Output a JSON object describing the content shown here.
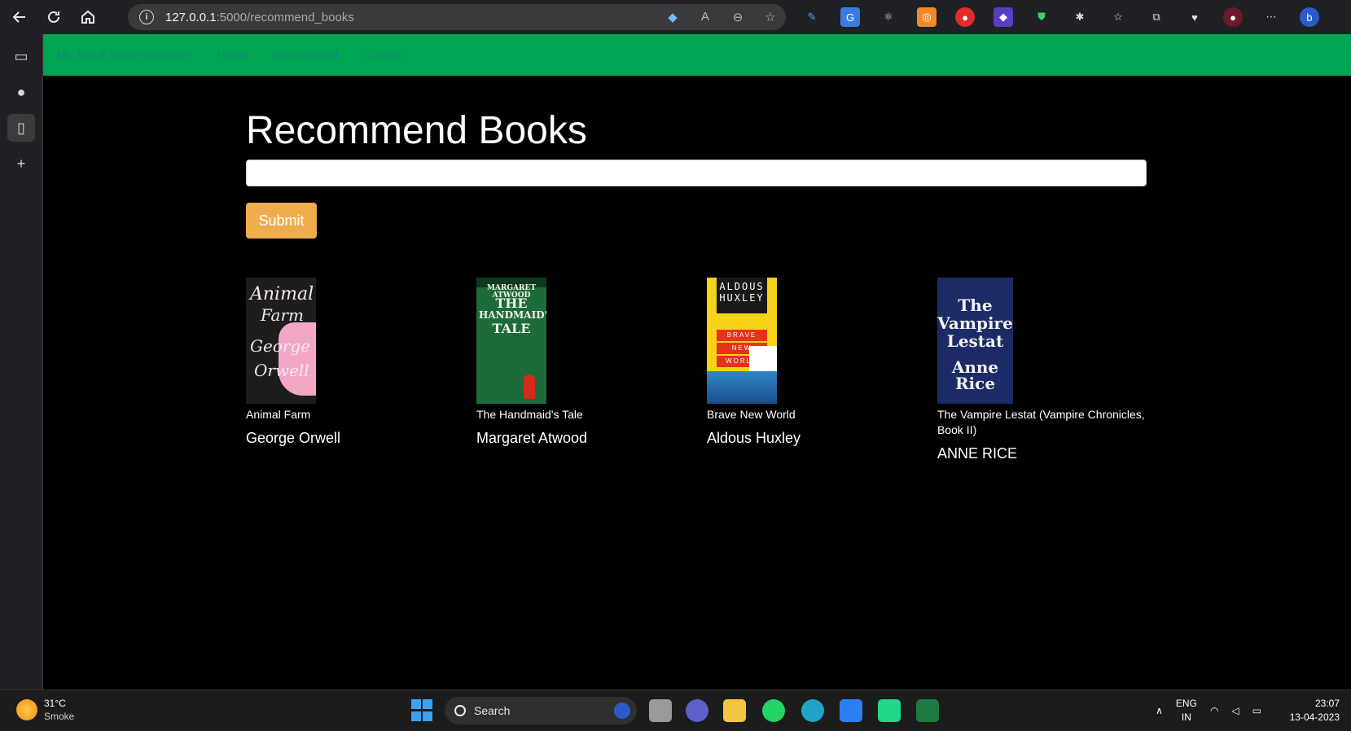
{
  "browser": {
    "url_host": "127.0.0.1",
    "url_path": ":5000/recommend_books"
  },
  "site_nav": {
    "brand": "My Book recommender",
    "links": [
      "Home",
      "Recommend",
      "Contact"
    ]
  },
  "main": {
    "title": "Recommend Books",
    "input_value": "",
    "submit_label": "Submit"
  },
  "books": [
    {
      "title": "Animal Farm",
      "author": "George Orwell",
      "cover_lines": [
        "Animal",
        "Farm",
        "George",
        "Orwell"
      ]
    },
    {
      "title": "The Handmaid's Tale",
      "author": "Margaret Atwood",
      "cover_lines": [
        "MARGARET ATWOOD",
        "THE",
        "HANDMAID'S",
        "TALE"
      ]
    },
    {
      "title": "Brave New World",
      "author": "Aldous Huxley",
      "cover_lines": [
        "ALDOUS",
        "HUXLEY",
        "BRAVE",
        "NEW",
        "WORLD"
      ]
    },
    {
      "title": "The Vampire Lestat (Vampire Chronicles, Book II)",
      "author": "ANNE RICE",
      "cover_lines": [
        "The",
        "Vampire",
        "Lestat",
        "Anne Rice"
      ]
    }
  ],
  "taskbar": {
    "weather_temp": "31°C",
    "weather_condition": "Smoke",
    "search_label": "Search",
    "lang_top": "ENG",
    "lang_bottom": "IN",
    "time": "23:07",
    "date": "13-04-2023"
  },
  "colors": {
    "nav_green": "#00a551",
    "submit_orange": "#f0ad4e",
    "page_background": "#000000"
  }
}
